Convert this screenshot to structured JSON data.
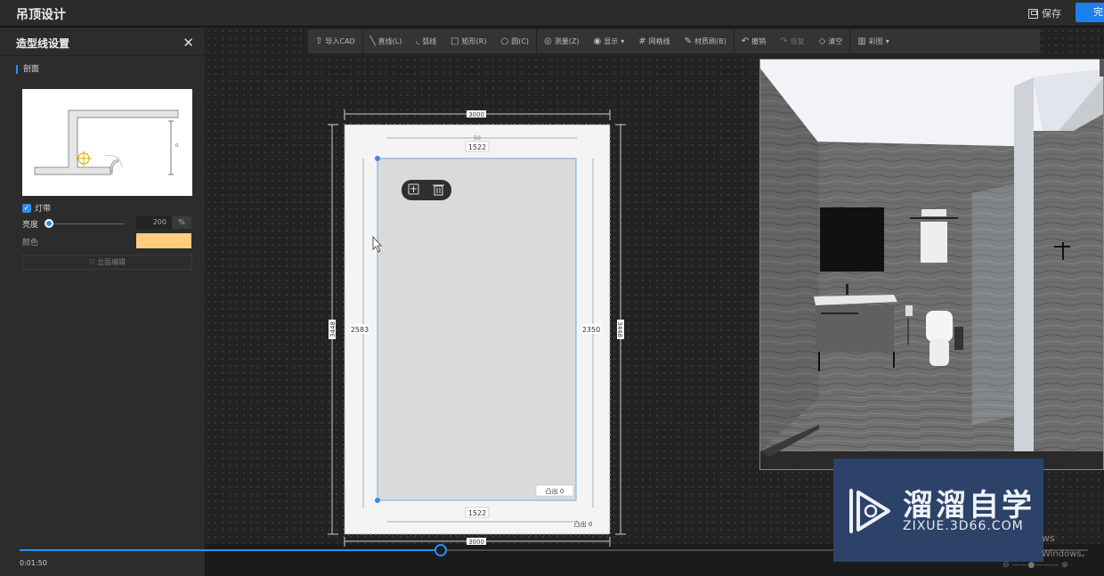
{
  "app": {
    "title": "吊顶设计",
    "save_label": "保存",
    "done_label": "完"
  },
  "panel": {
    "title": "造型线设置",
    "section": "剖面",
    "light_strip_label": "灯带",
    "brightness_label": "亮度",
    "brightness_value": "200",
    "brightness_unit": "%",
    "color_label": "颜色",
    "color_value": "#ffcc80",
    "edit_button": "立面编辑"
  },
  "toolbar": {
    "items": [
      {
        "label": "导入CAD",
        "icon": "upload-icon"
      },
      {
        "label": "直线(L)",
        "icon": "line-icon"
      },
      {
        "label": "弧线",
        "icon": "arc-icon"
      },
      {
        "label": "矩形(R)",
        "icon": "rectangle-icon"
      },
      {
        "label": "圆(C)",
        "icon": "circle-icon"
      },
      {
        "label": "测量(Z)",
        "icon": "measure-icon"
      },
      {
        "label": "显示",
        "icon": "eye-icon"
      },
      {
        "label": "网格线",
        "icon": "grid-icon"
      },
      {
        "label": "材质刷(B)",
        "icon": "brush-icon"
      },
      {
        "label": "撤销",
        "icon": "undo-icon"
      },
      {
        "label": "恢复",
        "icon": "redo-icon"
      },
      {
        "label": "清空",
        "icon": "eraser-icon"
      },
      {
        "label": "彩图",
        "icon": "map-icon"
      }
    ]
  },
  "drawing": {
    "outer_width": "3000",
    "outer_height": "3448",
    "inner_width_top": "1522",
    "inner_width_bottom": "1522",
    "left_offset": "2583",
    "right_offset": "2350",
    "top_small": "50",
    "bulge_inner": "凸出 0",
    "bulge_outer": "凸出 0",
    "bottom_label": "3000"
  },
  "timeline": {
    "time": "0:01:50",
    "progress": 0.393
  },
  "watermark": {
    "title": "溜溜自学",
    "subtitle": "ZIXUE.3D66.COM",
    "win1": "ws",
    "win2": "Windows。"
  }
}
